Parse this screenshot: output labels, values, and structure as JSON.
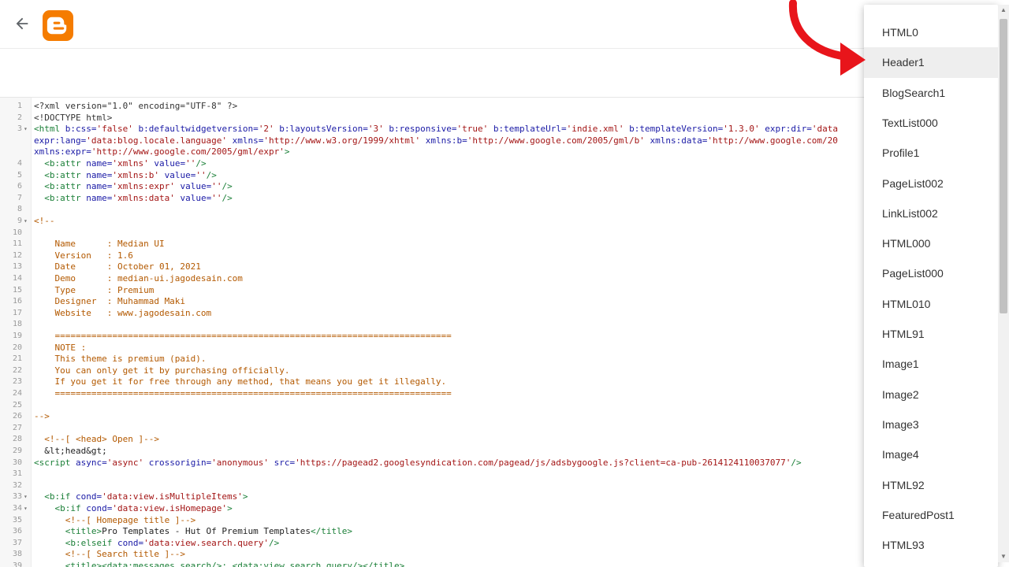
{
  "app": {
    "name": "Blogger",
    "accent": "#f57c00"
  },
  "icons": {
    "back": "arrow-left-icon",
    "logo": "blogger-logo-icon"
  },
  "editor": {
    "lines": [
      [
        [
          "pi",
          "<?xml version=\"1.0\" encoding=\"UTF-8\" ?>"
        ]
      ],
      [
        [
          "pi",
          "<!DOCTYPE html>"
        ]
      ],
      [
        [
          "tag",
          "<html "
        ],
        [
          "attr",
          "b:css="
        ],
        [
          "str",
          "'false'"
        ],
        [
          "attr",
          " b:defaultwidgetversion="
        ],
        [
          "str",
          "'2'"
        ],
        [
          "attr",
          " b:layoutsVersion="
        ],
        [
          "str",
          "'3'"
        ],
        [
          "attr",
          " b:responsive="
        ],
        [
          "str",
          "'true'"
        ],
        [
          "attr",
          " b:templateUrl="
        ],
        [
          "str",
          "'indie.xml'"
        ],
        [
          "attr",
          " b:templateVersion="
        ],
        [
          "str",
          "'1.3.0'"
        ],
        [
          "attr",
          " expr:dir="
        ],
        [
          "str",
          "'data"
        ]
      ],
      [
        [
          "attr",
          "expr:lang="
        ],
        [
          "str",
          "'data:blog.locale.language'"
        ],
        [
          "attr",
          " xmlns="
        ],
        [
          "str",
          "'http://www.w3.org/1999/xhtml'"
        ],
        [
          "attr",
          " xmlns:b="
        ],
        [
          "str",
          "'http://www.google.com/2005/gml/b'"
        ],
        [
          "attr",
          " xmlns:data="
        ],
        [
          "str",
          "'http://www.google.com/20"
        ]
      ],
      [
        [
          "attr",
          "xmlns:expr="
        ],
        [
          "str",
          "'http://www.google.com/2005/gml/expr'"
        ],
        [
          "tag",
          ">"
        ]
      ],
      [
        [
          "tag",
          "  <b:attr "
        ],
        [
          "attr",
          "name="
        ],
        [
          "str",
          "'xmlns'"
        ],
        [
          "attr",
          " value="
        ],
        [
          "str",
          "''"
        ],
        [
          "tag",
          "/>"
        ]
      ],
      [
        [
          "tag",
          "  <b:attr "
        ],
        [
          "attr",
          "name="
        ],
        [
          "str",
          "'xmlns:b'"
        ],
        [
          "attr",
          " value="
        ],
        [
          "str",
          "''"
        ],
        [
          "tag",
          "/>"
        ]
      ],
      [
        [
          "tag",
          "  <b:attr "
        ],
        [
          "attr",
          "name="
        ],
        [
          "str",
          "'xmlns:expr'"
        ],
        [
          "attr",
          " value="
        ],
        [
          "str",
          "''"
        ],
        [
          "tag",
          "/>"
        ]
      ],
      [
        [
          "tag",
          "  <b:attr "
        ],
        [
          "attr",
          "name="
        ],
        [
          "str",
          "'xmlns:data'"
        ],
        [
          "attr",
          " value="
        ],
        [
          "str",
          "''"
        ],
        [
          "tag",
          "/>"
        ]
      ],
      [],
      [
        [
          "cmt",
          "<!--"
        ]
      ],
      [],
      [
        [
          "cmt",
          "    Name      : Median UI"
        ]
      ],
      [
        [
          "cmt",
          "    Version   : 1.6"
        ]
      ],
      [
        [
          "cmt",
          "    Date      : October 01, 2021"
        ]
      ],
      [
        [
          "cmt",
          "    Demo      : median-ui.jagodesain.com"
        ]
      ],
      [
        [
          "cmt",
          "    Type      : Premium"
        ]
      ],
      [
        [
          "cmt",
          "    Designer  : Muhammad Maki"
        ]
      ],
      [
        [
          "cmt",
          "    Website   : www.jagodesain.com"
        ]
      ],
      [],
      [
        [
          "cmt",
          "    ============================================================================"
        ]
      ],
      [
        [
          "cmt",
          "    NOTE :"
        ]
      ],
      [
        [
          "cmt",
          "    This theme is premium (paid)."
        ]
      ],
      [
        [
          "cmt",
          "    You can only get it by purchasing officially."
        ]
      ],
      [
        [
          "cmt",
          "    If you get it for free through any method, that means you get it illegally."
        ]
      ],
      [
        [
          "cmt",
          "    ============================================================================"
        ]
      ],
      [],
      [
        [
          "cmt",
          "-->"
        ]
      ],
      [],
      [
        [
          "cmt",
          "  <!--[ <head> Open ]-->"
        ]
      ],
      [
        [
          "plain",
          "  &lt;head&gt;"
        ]
      ],
      [
        [
          "tag",
          "<script "
        ],
        [
          "attr",
          "async="
        ],
        [
          "str",
          "'async'"
        ],
        [
          "attr",
          " crossorigin="
        ],
        [
          "str",
          "'anonymous'"
        ],
        [
          "attr",
          " src="
        ],
        [
          "str",
          "'https://pagead2.googlesyndication.com/pagead/js/adsbygoogle.js?client=ca-pub-2614124110037077'"
        ],
        [
          "tag",
          "/>"
        ]
      ],
      [],
      [],
      [
        [
          "tag",
          "  <b:if "
        ],
        [
          "attr",
          "cond="
        ],
        [
          "str",
          "'data:view.isMultipleItems'"
        ],
        [
          "tag",
          ">"
        ]
      ],
      [
        [
          "tag",
          "    <b:if "
        ],
        [
          "attr",
          "cond="
        ],
        [
          "str",
          "'data:view.isHomepage'"
        ],
        [
          "tag",
          ">"
        ]
      ],
      [
        [
          "cmt",
          "      <!--[ Homepage title ]-->"
        ]
      ],
      [
        [
          "tag",
          "      <title>"
        ],
        [
          "plain",
          "Pro Templates - Hut Of Premium Templates"
        ],
        [
          "tag",
          "</title>"
        ]
      ],
      [
        [
          "tag",
          "      <b:elseif "
        ],
        [
          "attr",
          "cond="
        ],
        [
          "str",
          "'data:view.search.query'"
        ],
        [
          "tag",
          "/>"
        ]
      ],
      [
        [
          "cmt",
          "      <!--[ Search title ]-->"
        ]
      ],
      [
        [
          "tag",
          "      <title><data:messages.search/>: <data:view.search.query/></title>"
        ]
      ]
    ],
    "line_numbers": [
      "1",
      "2",
      "3",
      "",
      "",
      "4",
      "5",
      "6",
      "7",
      "8",
      "9",
      "10",
      "11",
      "12",
      "13",
      "14",
      "15",
      "16",
      "17",
      "18",
      "19",
      "20",
      "21",
      "22",
      "23",
      "24",
      "25",
      "26",
      "27",
      "28",
      "29",
      "30",
      "31",
      "32",
      "33",
      "34",
      "35",
      "36",
      "37",
      "38",
      "39"
    ],
    "fold_markers": [
      "",
      "",
      "▾",
      "",
      "",
      "",
      "",
      "",
      "",
      "",
      "▾",
      "",
      "",
      "",
      "",
      "",
      "",
      "",
      "",
      "",
      "",
      "",
      "",
      "",
      "",
      "",
      "",
      "",
      "",
      "",
      "",
      "",
      "",
      "",
      "▾",
      "▾",
      "",
      "",
      "",
      "",
      ""
    ]
  },
  "dropdown": {
    "active_index": 1,
    "items": [
      "HTML0",
      "Header1",
      "BlogSearch1",
      "TextList000",
      "Profile1",
      "PageList002",
      "LinkList002",
      "HTML000",
      "PageList000",
      "HTML010",
      "HTML91",
      "Image1",
      "Image2",
      "Image3",
      "Image4",
      "HTML92",
      "FeaturedPost1",
      "HTML93"
    ]
  },
  "colors": {
    "annotation_arrow": "#e8151b"
  }
}
